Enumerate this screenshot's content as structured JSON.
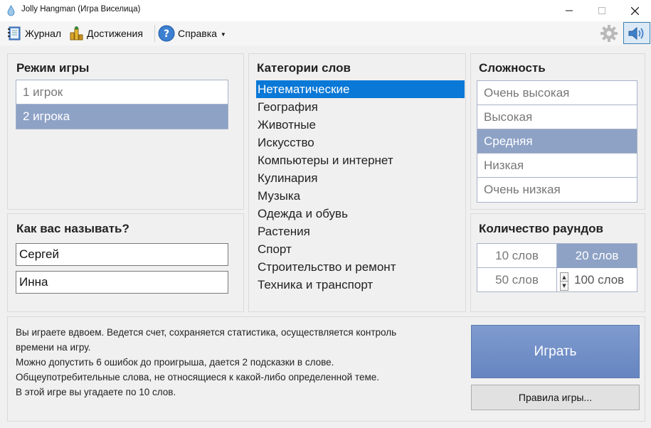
{
  "window": {
    "title": "Jolly Hangman (Игра Виселица)"
  },
  "toolbar": {
    "journal": "Журнал",
    "achievements": "Достижения",
    "help": "Справка"
  },
  "game_mode": {
    "title": "Режим игры",
    "options": [
      "1 игрок",
      "2 игрока"
    ],
    "selected": "2 игрока"
  },
  "names": {
    "title": "Как вас называть?",
    "player1": "Сергей",
    "player2": "Инна"
  },
  "categories": {
    "title": "Категории слов",
    "items": [
      "Нетематические",
      "География",
      "Животные",
      "Искусство",
      "Компьютеры и интернет",
      "Кулинария",
      "Музыка",
      "Одежда и обувь",
      "Растения",
      "Спорт",
      "Строительство и ремонт",
      "Техника и транспорт"
    ],
    "selected": "Нетематические"
  },
  "difficulty": {
    "title": "Сложность",
    "items": [
      "Очень высокая",
      "Высокая",
      "Средняя",
      "Низкая",
      "Очень низкая"
    ],
    "selected": "Средняя"
  },
  "rounds": {
    "title": "Количество раундов",
    "options": [
      "10 слов",
      "20 слов",
      "50 слов",
      "100 слов"
    ],
    "selected": "20 слов"
  },
  "description": {
    "lines": [
      "Вы играете вдвоем. Ведется счет, сохраняется статистика, осуществляется контроль",
      "времени на игру.",
      "Можно допустить 6 ошибок до проигрыша, дается 2 подсказки в слове.",
      "Общеупотребительные слова, не относящиеся к какой-либо определенной теме.",
      "В этой игре вы угадаете по 10 слов."
    ]
  },
  "actions": {
    "play": "Играть",
    "rules": "Правила игры..."
  },
  "colors": {
    "selection_blue": "#0a78d7",
    "selected_item": "#8ea2c6",
    "play_button": "#7391c8"
  }
}
